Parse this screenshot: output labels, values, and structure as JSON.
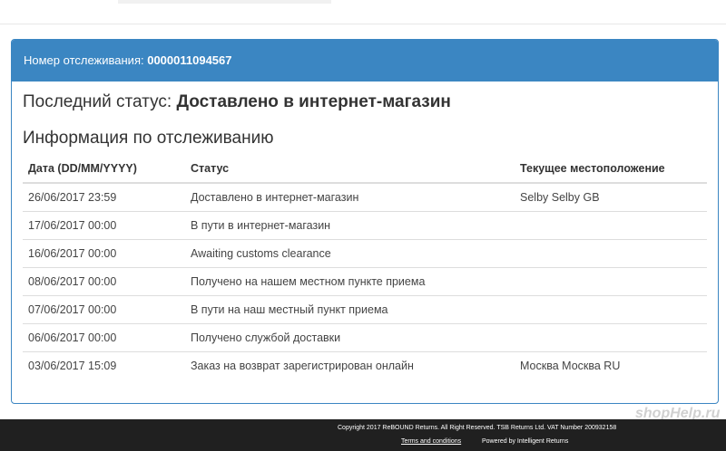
{
  "header": {
    "tracking_label": "Номер отслеживания:",
    "tracking_number": "0000011094567"
  },
  "status": {
    "label": "Последний статус:",
    "value": "Доставлено в интернет-магазин"
  },
  "tracking_info": {
    "title": "Информация по отслеживанию",
    "columns": [
      "Дата (DD/MM/YYYY)",
      "Статус",
      "Текущее местоположение"
    ],
    "rows": [
      {
        "date": "26/06/2017 23:59",
        "status": "Доставлено в интернет-магазин",
        "location": "Selby Selby GB"
      },
      {
        "date": "17/06/2017 00:00",
        "status": "В пути в интернет-магазин",
        "location": ""
      },
      {
        "date": "16/06/2017 00:00",
        "status": "Awaiting customs clearance",
        "location": ""
      },
      {
        "date": "08/06/2017 00:00",
        "status": "Получено на нашем местном пункте приема",
        "location": ""
      },
      {
        "date": "07/06/2017 00:00",
        "status": "В пути на наш местный пункт приема",
        "location": ""
      },
      {
        "date": "06/06/2017 00:00",
        "status": "Получено службой доставки",
        "location": ""
      },
      {
        "date": "03/06/2017 15:09",
        "status": "Заказ на возврат зарегистрирован онлайн",
        "location": "Москва Москва RU"
      }
    ]
  },
  "footer": {
    "copyright": "Copyright 2017 ReBOUND Returns. All Right Reserved. TSB Returns Ltd. VAT Number 200932158",
    "terms_link": "Terms and conditions",
    "powered_by": "Powered by Intelligent Returns"
  },
  "watermark": "shopHelp.ru",
  "colors": {
    "panel_heading_bg": "#3b86c2",
    "footer_bg": "#202020"
  }
}
